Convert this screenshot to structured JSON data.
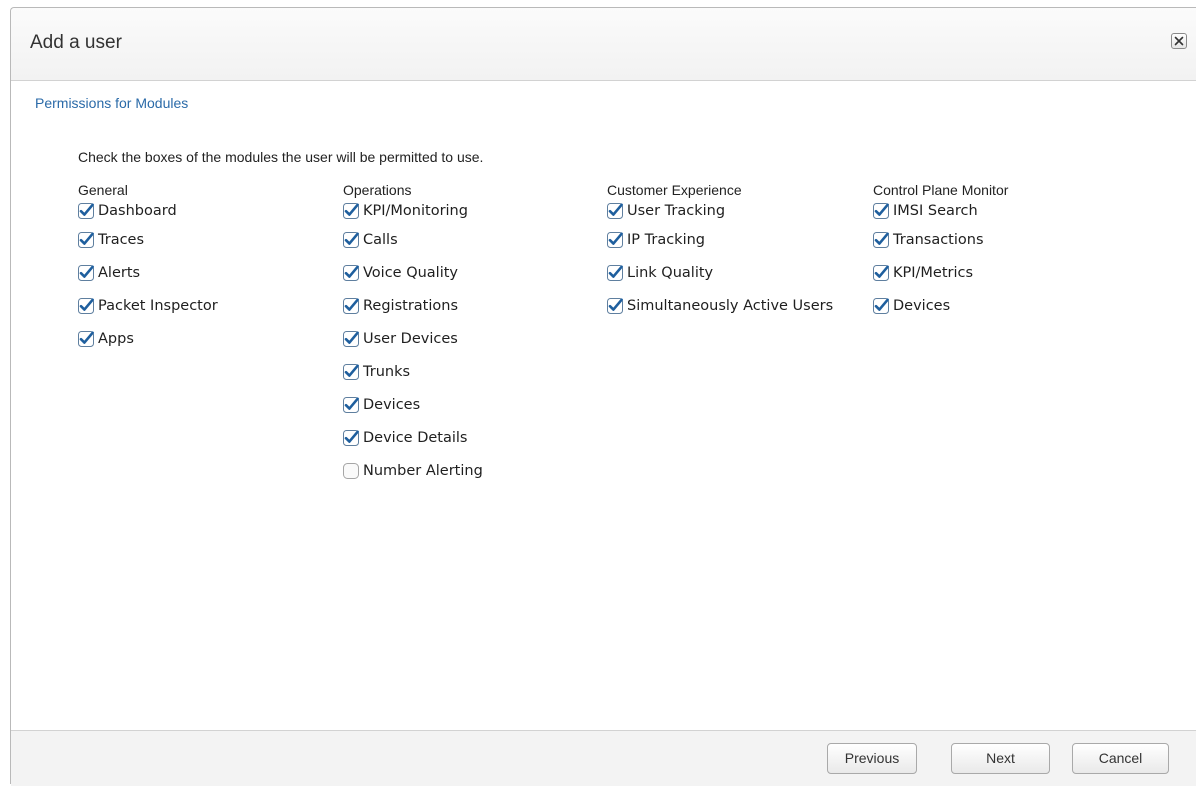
{
  "dialog": {
    "title": "Add a user",
    "close_icon": "close-x-icon"
  },
  "section": {
    "title": "Permissions for Modules",
    "instructions": "Check the boxes of the modules the user will be permitted to use."
  },
  "columns": [
    {
      "heading": "General",
      "items": [
        {
          "label": "Dashboard",
          "checked": true
        },
        {
          "label": "Traces",
          "checked": true
        },
        {
          "label": "Alerts",
          "checked": true
        },
        {
          "label": "Packet Inspector",
          "checked": true
        },
        {
          "label": "Apps",
          "checked": true
        }
      ]
    },
    {
      "heading": "Operations",
      "items": [
        {
          "label": "KPI/Monitoring",
          "checked": true
        },
        {
          "label": "Calls",
          "checked": true
        },
        {
          "label": "Voice Quality",
          "checked": true
        },
        {
          "label": "Registrations",
          "checked": true
        },
        {
          "label": "User Devices",
          "checked": true
        },
        {
          "label": "Trunks",
          "checked": true
        },
        {
          "label": "Devices",
          "checked": true
        },
        {
          "label": "Device Details",
          "checked": true
        },
        {
          "label": "Number Alerting",
          "checked": false
        }
      ]
    },
    {
      "heading": "Customer Experience",
      "items": [
        {
          "label": "User Tracking",
          "checked": true
        },
        {
          "label": "IP Tracking",
          "checked": true
        },
        {
          "label": "Link Quality",
          "checked": true
        },
        {
          "label": "Simultaneously Active Users",
          "checked": true
        }
      ]
    },
    {
      "heading": "Control Plane Monitor",
      "items": [
        {
          "label": "IMSI Search",
          "checked": true
        },
        {
          "label": "Transactions",
          "checked": true
        },
        {
          "label": "KPI/Metrics",
          "checked": true
        },
        {
          "label": "Devices",
          "checked": true
        }
      ]
    }
  ],
  "footer": {
    "previous_label": "Previous",
    "next_label": "Next",
    "cancel_label": "Cancel"
  },
  "colors": {
    "accent": "#2a6aa8",
    "checkbox_checked": "#1f5f9e"
  }
}
